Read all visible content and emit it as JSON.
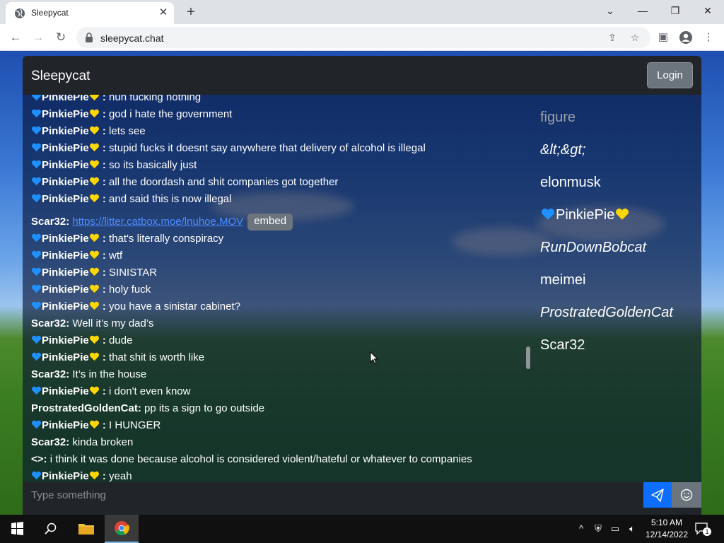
{
  "browser": {
    "tab_title": "Sleepycat",
    "url": "sleepycat.chat",
    "new_tab_symbol": "+",
    "close_symbol": "✕"
  },
  "app": {
    "title": "Sleepycat",
    "login_label": "Login",
    "input_placeholder": "Type something",
    "embed_label": "embed"
  },
  "messages": [
    {
      "user": "PinkiePie",
      "hearts": true,
      "sep": " : ",
      "text": "huh fucking nothing"
    },
    {
      "user": "PinkiePie",
      "hearts": true,
      "sep": " : ",
      "text": "god i hate the government"
    },
    {
      "user": "PinkiePie",
      "hearts": true,
      "sep": " : ",
      "text": "lets see"
    },
    {
      "user": "PinkiePie",
      "hearts": true,
      "sep": " : ",
      "text": "stupid fucks it doesnt say anywhere that delivery of alcohol is illegal"
    },
    {
      "user": "PinkiePie",
      "hearts": true,
      "sep": " : ",
      "text": "so its basically just"
    },
    {
      "user": "PinkiePie",
      "hearts": true,
      "sep": " : ",
      "text": "all the doordash and shit companies got together"
    },
    {
      "user": "PinkiePie",
      "hearts": true,
      "sep": " : ",
      "text": "and said this is now illegal"
    },
    {
      "user": "Scar32",
      "hearts": false,
      "sep": ": ",
      "text": "",
      "link": "https://litter.catbox.moe/lnuhoe.MOV",
      "embed": true
    },
    {
      "user": "PinkiePie",
      "hearts": true,
      "sep": " : ",
      "text": "that's literally conspiracy"
    },
    {
      "user": "PinkiePie",
      "hearts": true,
      "sep": " : ",
      "text": "wtf"
    },
    {
      "user": "PinkiePie",
      "hearts": true,
      "sep": " : ",
      "text": "SINISTAR"
    },
    {
      "user": "PinkiePie",
      "hearts": true,
      "sep": " : ",
      "text": "holy fuck"
    },
    {
      "user": "PinkiePie",
      "hearts": true,
      "sep": " : ",
      "text": "you have a sinistar cabinet?"
    },
    {
      "user": "Scar32",
      "hearts": false,
      "sep": ": ",
      "text": "Well it’s my dad’s"
    },
    {
      "user": "PinkiePie",
      "hearts": true,
      "sep": " : ",
      "text": "dude"
    },
    {
      "user": "PinkiePie",
      "hearts": true,
      "sep": " : ",
      "text": "that shit is worth like"
    },
    {
      "user": "Scar32",
      "hearts": false,
      "sep": ": ",
      "text": "It’s in the house"
    },
    {
      "user": "PinkiePie",
      "hearts": true,
      "sep": " : ",
      "text": "i don't even know"
    },
    {
      "user": "ProstratedGoldenCat",
      "hearts": false,
      "sep": ": ",
      "text": "pp its a sign to go outside"
    },
    {
      "user": "PinkiePie",
      "hearts": true,
      "sep": " : ",
      "text": "I HUNGER"
    },
    {
      "user": "Scar32",
      "hearts": false,
      "sep": ": ",
      "text": "kinda broken"
    },
    {
      "user": "<>",
      "hearts": false,
      "sep": ": ",
      "text": "i think it was done because alcohol is considered violent/hateful or whatever to companies"
    },
    {
      "user": "PinkiePie",
      "hearts": true,
      "sep": " : ",
      "text": "yeah"
    }
  ],
  "users": [
    {
      "name": "figure",
      "style": "faded"
    },
    {
      "name": "&lt;&gt;",
      "style": "italic"
    },
    {
      "name": "elonmusk",
      "style": "normal"
    },
    {
      "name": "PinkiePie",
      "style": "hearts"
    },
    {
      "name": "RunDownBobcat",
      "style": "italic"
    },
    {
      "name": "meimei",
      "style": "normal"
    },
    {
      "name": "ProstratedGoldenCat",
      "style": "italic"
    },
    {
      "name": "Scar32",
      "style": "normal"
    }
  ],
  "taskbar": {
    "time": "5:10 AM",
    "date": "12/14/2022",
    "notification_count": "1"
  },
  "colors": {
    "heart_blue": "#1e90ff",
    "heart_yellow": "#ffd700",
    "link": "#4d8cff",
    "send_button": "#0d6efd"
  }
}
